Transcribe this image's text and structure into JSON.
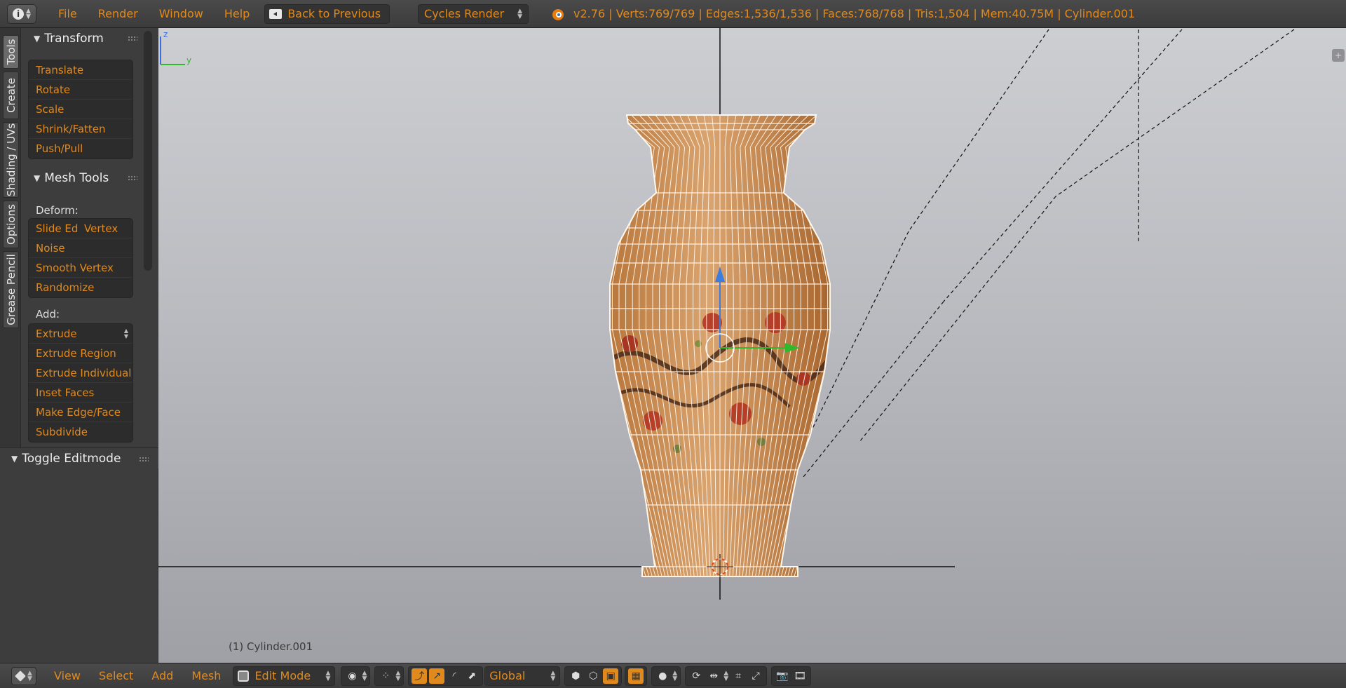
{
  "header": {
    "menu": [
      "File",
      "Render",
      "Window",
      "Help"
    ],
    "back_label": "Back to Previous",
    "render_engine": "Cycles Render",
    "stats": "v2.76 | Verts:769/769 | Edges:1,536/1,536 | Faces:768/768 | Tris:1,504 | Mem:40.75M | Cylinder.001"
  },
  "tabs": [
    "Tools",
    "Create",
    "Shading / UVs",
    "Options",
    "Grease Pencil"
  ],
  "tool_shelf": {
    "transform": {
      "title": "Transform",
      "buttons": [
        "Translate",
        "Rotate",
        "Scale",
        "Shrink/Fatten",
        "Push/Pull"
      ]
    },
    "mesh_tools": {
      "title": "Mesh Tools",
      "deform_label": "Deform:",
      "slide_edge": "Slide Ed",
      "vertex": "Vertex",
      "deform_buttons": [
        "Noise",
        "Smooth Vertex",
        "Randomize"
      ],
      "add_label": "Add:",
      "extrude": "Extrude",
      "add_buttons": [
        "Extrude Region",
        "Extrude Individual",
        "Inset Faces",
        "Make Edge/Face",
        "Subdivide"
      ]
    },
    "toggle_editmode": "Toggle Editmode"
  },
  "viewport": {
    "object_label": "(1) Cylinder.001",
    "axis_z": "z",
    "axis_y": "y"
  },
  "footer": {
    "menu": [
      "View",
      "Select",
      "Add",
      "Mesh"
    ],
    "mode": "Edit Mode",
    "orientation": "Global"
  },
  "colors": {
    "accent": "#e08a1e",
    "panel_bg": "#3d3d3d",
    "viewport_top": "#cdced2",
    "viewport_bottom": "#9fa0a6",
    "vase": "#c98e55"
  }
}
